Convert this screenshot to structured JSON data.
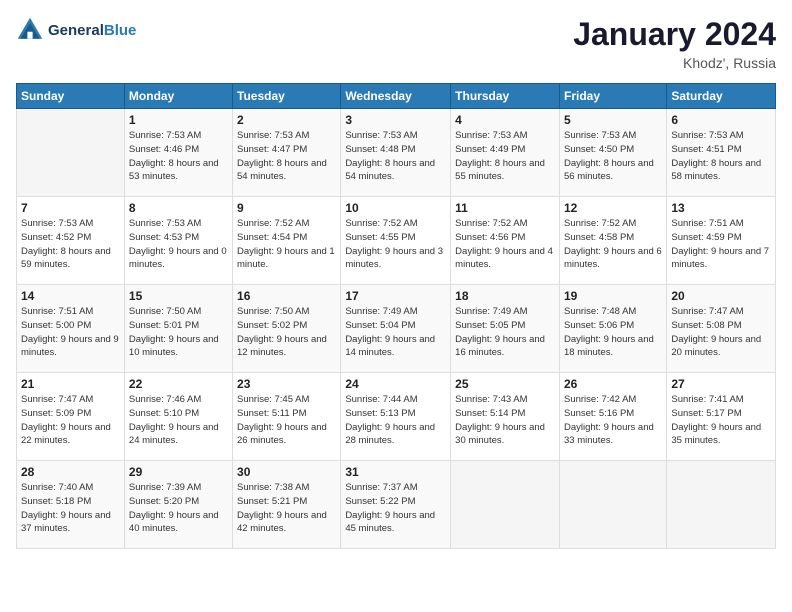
{
  "logo": {
    "line1": "General",
    "line2": "Blue"
  },
  "title": "January 2024",
  "location": "Khodz', Russia",
  "days_header": [
    "Sunday",
    "Monday",
    "Tuesday",
    "Wednesday",
    "Thursday",
    "Friday",
    "Saturday"
  ],
  "weeks": [
    [
      {
        "day": "",
        "sunrise": "",
        "sunset": "",
        "daylight": ""
      },
      {
        "day": "1",
        "sunrise": "Sunrise: 7:53 AM",
        "sunset": "Sunset: 4:46 PM",
        "daylight": "Daylight: 8 hours and 53 minutes."
      },
      {
        "day": "2",
        "sunrise": "Sunrise: 7:53 AM",
        "sunset": "Sunset: 4:47 PM",
        "daylight": "Daylight: 8 hours and 54 minutes."
      },
      {
        "day": "3",
        "sunrise": "Sunrise: 7:53 AM",
        "sunset": "Sunset: 4:48 PM",
        "daylight": "Daylight: 8 hours and 54 minutes."
      },
      {
        "day": "4",
        "sunrise": "Sunrise: 7:53 AM",
        "sunset": "Sunset: 4:49 PM",
        "daylight": "Daylight: 8 hours and 55 minutes."
      },
      {
        "day": "5",
        "sunrise": "Sunrise: 7:53 AM",
        "sunset": "Sunset: 4:50 PM",
        "daylight": "Daylight: 8 hours and 56 minutes."
      },
      {
        "day": "6",
        "sunrise": "Sunrise: 7:53 AM",
        "sunset": "Sunset: 4:51 PM",
        "daylight": "Daylight: 8 hours and 58 minutes."
      }
    ],
    [
      {
        "day": "7",
        "sunrise": "Sunrise: 7:53 AM",
        "sunset": "Sunset: 4:52 PM",
        "daylight": "Daylight: 8 hours and 59 minutes."
      },
      {
        "day": "8",
        "sunrise": "Sunrise: 7:53 AM",
        "sunset": "Sunset: 4:53 PM",
        "daylight": "Daylight: 9 hours and 0 minutes."
      },
      {
        "day": "9",
        "sunrise": "Sunrise: 7:52 AM",
        "sunset": "Sunset: 4:54 PM",
        "daylight": "Daylight: 9 hours and 1 minute."
      },
      {
        "day": "10",
        "sunrise": "Sunrise: 7:52 AM",
        "sunset": "Sunset: 4:55 PM",
        "daylight": "Daylight: 9 hours and 3 minutes."
      },
      {
        "day": "11",
        "sunrise": "Sunrise: 7:52 AM",
        "sunset": "Sunset: 4:56 PM",
        "daylight": "Daylight: 9 hours and 4 minutes."
      },
      {
        "day": "12",
        "sunrise": "Sunrise: 7:52 AM",
        "sunset": "Sunset: 4:58 PM",
        "daylight": "Daylight: 9 hours and 6 minutes."
      },
      {
        "day": "13",
        "sunrise": "Sunrise: 7:51 AM",
        "sunset": "Sunset: 4:59 PM",
        "daylight": "Daylight: 9 hours and 7 minutes."
      }
    ],
    [
      {
        "day": "14",
        "sunrise": "Sunrise: 7:51 AM",
        "sunset": "Sunset: 5:00 PM",
        "daylight": "Daylight: 9 hours and 9 minutes."
      },
      {
        "day": "15",
        "sunrise": "Sunrise: 7:50 AM",
        "sunset": "Sunset: 5:01 PM",
        "daylight": "Daylight: 9 hours and 10 minutes."
      },
      {
        "day": "16",
        "sunrise": "Sunrise: 7:50 AM",
        "sunset": "Sunset: 5:02 PM",
        "daylight": "Daylight: 9 hours and 12 minutes."
      },
      {
        "day": "17",
        "sunrise": "Sunrise: 7:49 AM",
        "sunset": "Sunset: 5:04 PM",
        "daylight": "Daylight: 9 hours and 14 minutes."
      },
      {
        "day": "18",
        "sunrise": "Sunrise: 7:49 AM",
        "sunset": "Sunset: 5:05 PM",
        "daylight": "Daylight: 9 hours and 16 minutes."
      },
      {
        "day": "19",
        "sunrise": "Sunrise: 7:48 AM",
        "sunset": "Sunset: 5:06 PM",
        "daylight": "Daylight: 9 hours and 18 minutes."
      },
      {
        "day": "20",
        "sunrise": "Sunrise: 7:47 AM",
        "sunset": "Sunset: 5:08 PM",
        "daylight": "Daylight: 9 hours and 20 minutes."
      }
    ],
    [
      {
        "day": "21",
        "sunrise": "Sunrise: 7:47 AM",
        "sunset": "Sunset: 5:09 PM",
        "daylight": "Daylight: 9 hours and 22 minutes."
      },
      {
        "day": "22",
        "sunrise": "Sunrise: 7:46 AM",
        "sunset": "Sunset: 5:10 PM",
        "daylight": "Daylight: 9 hours and 24 minutes."
      },
      {
        "day": "23",
        "sunrise": "Sunrise: 7:45 AM",
        "sunset": "Sunset: 5:11 PM",
        "daylight": "Daylight: 9 hours and 26 minutes."
      },
      {
        "day": "24",
        "sunrise": "Sunrise: 7:44 AM",
        "sunset": "Sunset: 5:13 PM",
        "daylight": "Daylight: 9 hours and 28 minutes."
      },
      {
        "day": "25",
        "sunrise": "Sunrise: 7:43 AM",
        "sunset": "Sunset: 5:14 PM",
        "daylight": "Daylight: 9 hours and 30 minutes."
      },
      {
        "day": "26",
        "sunrise": "Sunrise: 7:42 AM",
        "sunset": "Sunset: 5:16 PM",
        "daylight": "Daylight: 9 hours and 33 minutes."
      },
      {
        "day": "27",
        "sunrise": "Sunrise: 7:41 AM",
        "sunset": "Sunset: 5:17 PM",
        "daylight": "Daylight: 9 hours and 35 minutes."
      }
    ],
    [
      {
        "day": "28",
        "sunrise": "Sunrise: 7:40 AM",
        "sunset": "Sunset: 5:18 PM",
        "daylight": "Daylight: 9 hours and 37 minutes."
      },
      {
        "day": "29",
        "sunrise": "Sunrise: 7:39 AM",
        "sunset": "Sunset: 5:20 PM",
        "daylight": "Daylight: 9 hours and 40 minutes."
      },
      {
        "day": "30",
        "sunrise": "Sunrise: 7:38 AM",
        "sunset": "Sunset: 5:21 PM",
        "daylight": "Daylight: 9 hours and 42 minutes."
      },
      {
        "day": "31",
        "sunrise": "Sunrise: 7:37 AM",
        "sunset": "Sunset: 5:22 PM",
        "daylight": "Daylight: 9 hours and 45 minutes."
      },
      {
        "day": "",
        "sunrise": "",
        "sunset": "",
        "daylight": ""
      },
      {
        "day": "",
        "sunrise": "",
        "sunset": "",
        "daylight": ""
      },
      {
        "day": "",
        "sunrise": "",
        "sunset": "",
        "daylight": ""
      }
    ]
  ]
}
